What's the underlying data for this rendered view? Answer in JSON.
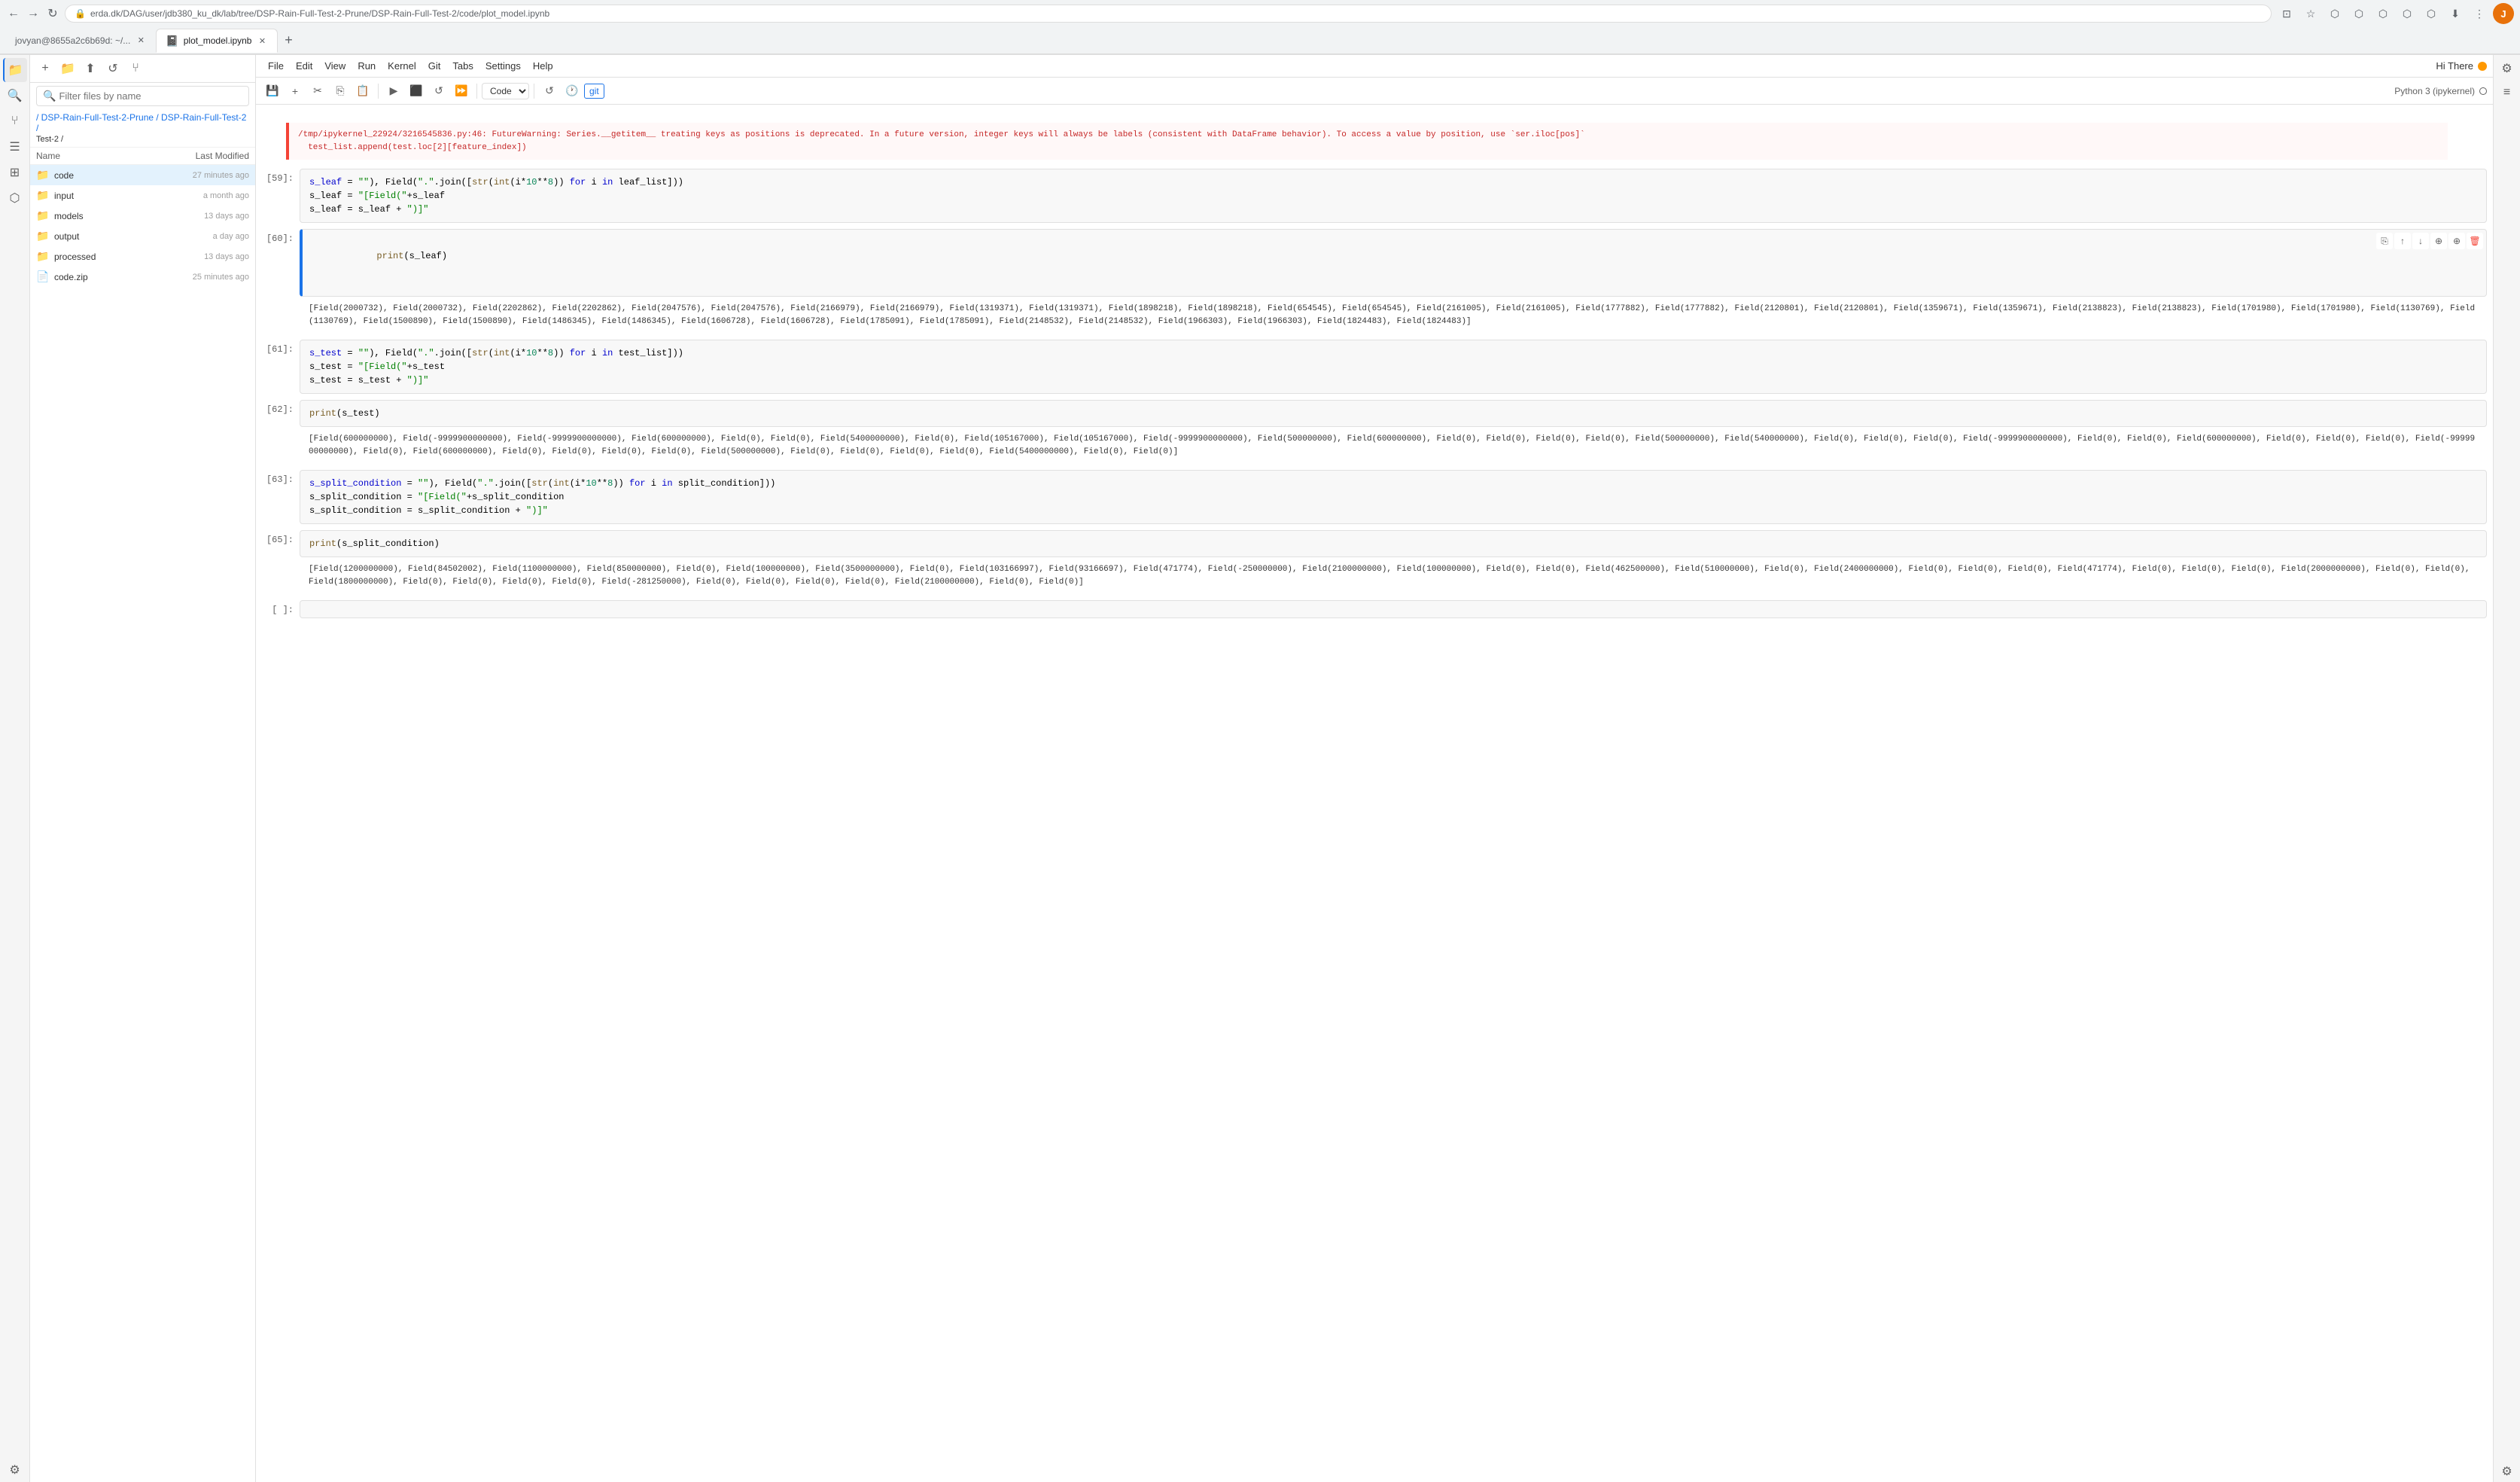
{
  "browser": {
    "url": "erda.dk/DAG/user/jdb380_ku_dk/lab/tree/DSP-Rain-Full-Test-2-Prune/DSP-Rain-Full-Test-2/code/plot_model.ipynb",
    "back": "←",
    "forward": "→",
    "refresh": "↺",
    "tab1_label": "jovyan@8655a2c6b69d: ~/...",
    "tab2_label": "plot_model.ipynb",
    "new_tab": "+",
    "profile_letter": "J",
    "hi_there": "Hi There"
  },
  "menu": {
    "items": [
      "File",
      "Edit",
      "View",
      "Run",
      "Kernel",
      "Git",
      "Tabs",
      "Settings",
      "Help"
    ]
  },
  "file_panel": {
    "search_placeholder": "Filter files by name",
    "breadcrumb": "/ DSP-Rain-Full-Test-2-Prune / DSP-Rain-Full-Test-2 /",
    "col_name": "Name",
    "col_modified": "Last Modified",
    "files": [
      {
        "name": "code",
        "type": "folder",
        "modified": "27 minutes ago",
        "selected": true
      },
      {
        "name": "input",
        "type": "folder",
        "modified": "a month ago"
      },
      {
        "name": "models",
        "type": "folder",
        "modified": "13 days ago"
      },
      {
        "name": "output",
        "type": "folder",
        "modified": "a day ago"
      },
      {
        "name": "processed",
        "type": "folder",
        "modified": "13 days ago"
      },
      {
        "name": "code.zip",
        "type": "file",
        "modified": "25 minutes ago"
      }
    ]
  },
  "notebook": {
    "title": "plot_model.ipynb",
    "kernel": "Python 3 (ipykernel)",
    "cell_type": "Code",
    "git_label": "git",
    "toolbar_btns": [
      "save",
      "add-cell",
      "cut",
      "copy",
      "paste",
      "run",
      "interrupt",
      "restart",
      "run-all",
      "cell-type"
    ],
    "cells": [
      {
        "number": "",
        "type": "error",
        "output": "/tmp/ipykernel_22924/3216545836.py:46: FutureWarning: Series.__getitem__ treating keys as positions is deprecated. In a future version, integer keys will always be labels (consistent with DataFrame behavior). To access a value by position, use `ser.iloc[pos]`\n  test_list.append(test.loc[2][feature_index])"
      },
      {
        "number": "[59]:",
        "type": "input",
        "code": "s_leaf = \"\"), Field(\".\".join([str(int(i*10**8)) for i in leaf_list]))\ns_leaf = \"[Field(\"+s_leaf\ns_leaf = s_leaf + \")]\""
      },
      {
        "number": "[60]:",
        "type": "input-output",
        "code": "print(s_leaf)",
        "output": "[Field(2000732), Field(2000732), Field(2202862), Field(2202862), Field(2047576), Field(2047576), Field(2166979), Field(2166979), Field(1319371), Field(1319371), Field(1898218), Field(1898218), Field(654545), Field(654545), Field(2161005), Field(2161005), Field(1777882), Field(1777882), Field(2120801), Field(2120801), Field(1359671), Field(1359671), Field(2138823), Field(2138823), Field(1701980), Field(1701980), Field(1130769), Field(1130769), Field(1500890), Field(1500890), Field(1486345), Field(1486345), Field(1606728), Field(1606728), Field(1785091), Field(1785091), Field(2148532), Field(2148532), Field(1966303), Field(1966303), Field(1824483), Field(1824483)]",
        "actions": [
          "copy",
          "up",
          "down",
          "add-above",
          "add-below",
          "delete"
        ]
      },
      {
        "number": "[61]:",
        "type": "input",
        "code": "s_test = \"\"), Field(\".\".join([str(int(i*10**8)) for i in test_list]))\ns_test = \"[Field(\"+s_test\ns_test = s_test + \")]\""
      },
      {
        "number": "[62]:",
        "type": "input-output",
        "code": "print(s_test)",
        "output": "[Field(600000000), Field(-9999900000000), Field(-9999900000000), Field(600000000), Field(0), Field(0), Field(5400000000), Field(0), Field(105167000), Field(105167000), Field(-9999900000000), Field(500000000), Field(600000000), Field(0), Field(0), Field(0), Field(0), Field(500000000), Field(540000000), Field(0), Field(0), Field(0), Field(-9999900000000), Field(0), Field(0), Field(600000000), Field(0), Field(0), Field(0), Field(-9999900000000), Field(0), Field(600000000), Field(0), Field(0), Field(0), Field(0), Field(500000000), Field(0), Field(0), Field(0), Field(0), Field(5400000000), Field(0), Field(0)]"
      },
      {
        "number": "[63]:",
        "type": "input",
        "code": "s_split_condition = \"\"), Field(\".\".join([str(int(i*10**8)) for i in split_condition]))\ns_split_condition = \"[Field(\"+s_split_condition\ns_split_condition = s_split_condition + \")]\""
      },
      {
        "number": "[65]:",
        "type": "input-output",
        "code": "print(s_split_condition)",
        "output": "[Field(1200000000), Field(84502002), Field(1100000000), Field(850000000), Field(0), Field(100000000), Field(3500000000), Field(0), Field(103166997), Field(93166697), Field(471774), Field(-250000000), Field(2100000000), Field(100000000), Field(0), Field(0), Field(462500000), Field(510000000), Field(0), Field(2400000000), Field(0), Field(0), Field(0), Field(471774), Field(0), Field(0), Field(0), Field(2000000000), Field(0), Field(0), Field(1800000000), Field(0), Field(0), Field(0), Field(0), Field(-281250000), Field(0), Field(0), Field(0), Field(0), Field(2100000000), Field(0), Field(0)]"
      },
      {
        "number": "[  ]:",
        "type": "empty",
        "code": ""
      }
    ]
  }
}
